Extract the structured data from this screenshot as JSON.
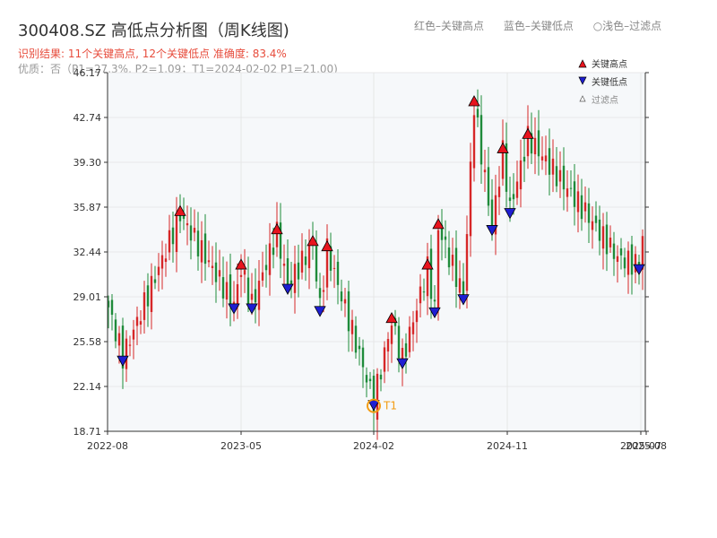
{
  "header": {
    "title": "300408.SZ 高低点分析图（周K线图)",
    "legend_red": "红色–关键高点",
    "legend_blue": "蓝色–关键低点",
    "legend_hollow": "○浅色–过滤点",
    "result": "识别结果: 11个关键高点, 12个关键低点  准确度: 83.4%",
    "quality": "优质：否（P1=27.3%, P2=1.09；T1=2024-02-02 P1=21.00)"
  },
  "colors": {
    "up": "#d62728",
    "down": "#1f8b3a",
    "high": "#e8141e",
    "low": "#1e1ed2",
    "accent": "#f39c12",
    "plot_bg": "#f6f8fa"
  },
  "chart_data": {
    "type": "candlestick",
    "y_ticks": [
      "46.17",
      "42.74",
      "39.30",
      "35.87",
      "32.44",
      "29.01",
      "25.58",
      "22.14",
      "18.71"
    ],
    "ylim": [
      18.71,
      46.17
    ],
    "x_ticks": [
      "2022-08",
      "2023-05",
      "2024-02",
      "2024-11",
      "2025-07",
      "2025-08"
    ],
    "legend": [
      "关键高点",
      "关键低点",
      "过滤点"
    ],
    "annotation": "T1",
    "T1": {
      "index": 74,
      "price": 21.0
    },
    "highs": [
      {
        "index": 20,
        "price": 35.3
      },
      {
        "index": 37,
        "price": 31.2
      },
      {
        "index": 47,
        "price": 33.9
      },
      {
        "index": 57,
        "price": 33.0
      },
      {
        "index": 61,
        "price": 32.6
      },
      {
        "index": 79,
        "price": 27.1
      },
      {
        "index": 89,
        "price": 31.2
      },
      {
        "index": 92,
        "price": 34.3
      },
      {
        "index": 102,
        "price": 43.7
      },
      {
        "index": 110,
        "price": 40.1
      },
      {
        "index": 117,
        "price": 41.2
      }
    ],
    "lows": [
      {
        "index": 4,
        "price": 24.4
      },
      {
        "index": 35,
        "price": 28.4
      },
      {
        "index": 40,
        "price": 28.4
      },
      {
        "index": 50,
        "price": 29.9
      },
      {
        "index": 59,
        "price": 28.2
      },
      {
        "index": 74,
        "price": 21.0
      },
      {
        "index": 82,
        "price": 24.2
      },
      {
        "index": 91,
        "price": 28.1
      },
      {
        "index": 99,
        "price": 29.1
      },
      {
        "index": 107,
        "price": 34.4
      },
      {
        "index": 112,
        "price": 35.7
      },
      {
        "index": 148,
        "price": 31.4
      }
    ]
  }
}
